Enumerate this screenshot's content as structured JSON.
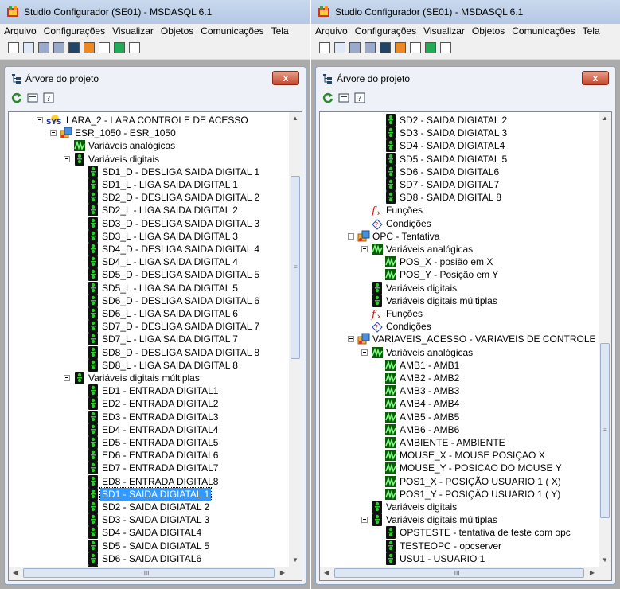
{
  "left": {
    "title": "Studio Configurador (SE01) - MSDASQL 6.1",
    "menu": [
      "Arquivo",
      "Configurações",
      "Visualizar",
      "Objetos",
      "Comunicações",
      "Tela"
    ],
    "panel_title": "Árvore do projeto",
    "close_label": "x",
    "hscroll_grip": "III",
    "vscroll_grip": "≡",
    "tree": [
      {
        "depth": 0,
        "icon": "sys",
        "label": "LARA_2 - LARA CONTROLE DE ACESSO",
        "expander": true
      },
      {
        "depth": 1,
        "icon": "device",
        "label": "ESR_1050 - ESR_1050",
        "expander": true
      },
      {
        "depth": 2,
        "icon": "analog",
        "label": "Variáveis analógicas"
      },
      {
        "depth": 2,
        "icon": "digital",
        "label": "Variáveis digitais",
        "expander": true
      },
      {
        "depth": 3,
        "icon": "digital",
        "label": "SD1_D - DESLIGA SAIDA DIGITAL 1"
      },
      {
        "depth": 3,
        "icon": "digital",
        "label": "SD1_L - LIGA SAIDA DIGITAL 1"
      },
      {
        "depth": 3,
        "icon": "digital",
        "label": "SD2_D - DESLIGA SAIDA DIGITAL 2"
      },
      {
        "depth": 3,
        "icon": "digital",
        "label": "SD2_L - LIGA SAIDA DIGITAL 2"
      },
      {
        "depth": 3,
        "icon": "digital",
        "label": "SD3_D - DESLIGA SAIDA DIGITAL 3"
      },
      {
        "depth": 3,
        "icon": "digital",
        "label": "SD3_L - LIGA SAIDA DIGITAL 3"
      },
      {
        "depth": 3,
        "icon": "digital",
        "label": "SD4_D - DESLIGA SAIDA DIGITAL 4"
      },
      {
        "depth": 3,
        "icon": "digital",
        "label": "SD4_L - LIGA SAIDA DIGITAL 4"
      },
      {
        "depth": 3,
        "icon": "digital",
        "label": "SD5_D - DESLIGA SAIDA DIGITAL 5"
      },
      {
        "depth": 3,
        "icon": "digital",
        "label": "SD5_L - LIGA SAIDA DIGITAL 5"
      },
      {
        "depth": 3,
        "icon": "digital",
        "label": "SD6_D - DESLIGA SAIDA DIGITAL 6"
      },
      {
        "depth": 3,
        "icon": "digital",
        "label": "SD6_L - LIGA SAIDA DIGITAL 6"
      },
      {
        "depth": 3,
        "icon": "digital",
        "label": "SD7_D - DESLIGA SAIDA DIGITAL 7"
      },
      {
        "depth": 3,
        "icon": "digital",
        "label": "SD7_L - LIGA SAIDA DIGITAL 7"
      },
      {
        "depth": 3,
        "icon": "digital",
        "label": "SD8_D - DESLIGA SAIDA DIGITAL 8"
      },
      {
        "depth": 3,
        "icon": "digital",
        "label": "SD8_L - LIGA SAIDA DIGITAL 8"
      },
      {
        "depth": 2,
        "icon": "digital",
        "label": "Variáveis digitais múltiplas",
        "expander": true
      },
      {
        "depth": 3,
        "icon": "digital",
        "label": "ED1 - ENTRADA DIGITAL1"
      },
      {
        "depth": 3,
        "icon": "digital",
        "label": "ED2 - ENTRADA DIGITAL2"
      },
      {
        "depth": 3,
        "icon": "digital",
        "label": "ED3 - ENTRADA DIGITAL3"
      },
      {
        "depth": 3,
        "icon": "digital",
        "label": "ED4 - ENTRADA DIGITAL4"
      },
      {
        "depth": 3,
        "icon": "digital",
        "label": "ED5 - ENTRADA DIGITAL5"
      },
      {
        "depth": 3,
        "icon": "digital",
        "label": "ED6 - ENTRADA DIGITAL6"
      },
      {
        "depth": 3,
        "icon": "digital",
        "label": "ED7 - ENTRADA DIGITAL7"
      },
      {
        "depth": 3,
        "icon": "digital",
        "label": "ED8 - ENTRADA DIGITAL8"
      },
      {
        "depth": 3,
        "icon": "digital",
        "label": "SD1 - SAIDA DIGIATAL 1",
        "selected": true
      },
      {
        "depth": 3,
        "icon": "digital",
        "label": "SD2 - SAIDA DIGIATAL 2"
      },
      {
        "depth": 3,
        "icon": "digital",
        "label": "SD3 - SAIDA DIGIATAL 3"
      },
      {
        "depth": 3,
        "icon": "digital",
        "label": "SD4 - SAIDA DIGITAL4"
      },
      {
        "depth": 3,
        "icon": "digital",
        "label": "SD5 - SAIDA DIGIATAL 5"
      },
      {
        "depth": 3,
        "icon": "digital",
        "label": "SD6 - SAIDA DIGITAL6"
      },
      {
        "depth": 3,
        "icon": "digital",
        "label": "SD7 - SAIDA DIGITAL7"
      }
    ]
  },
  "right": {
    "title": "Studio Configurador (SE01) - MSDASQL 6.1",
    "menu": [
      "Arquivo",
      "Configurações",
      "Visualizar",
      "Objetos",
      "Comunicações",
      "Tela"
    ],
    "panel_title": "Árvore do projeto",
    "close_label": "x",
    "hscroll_grip": "III",
    "vscroll_grip": "≡",
    "tree": [
      {
        "depth": 3,
        "icon": "digital",
        "label": "SD2 - SAIDA DIGIATAL 2"
      },
      {
        "depth": 3,
        "icon": "digital",
        "label": "SD3 - SAIDA DIGIATAL 3"
      },
      {
        "depth": 3,
        "icon": "digital",
        "label": "SD4 - SAIDA DIGIATAL4"
      },
      {
        "depth": 3,
        "icon": "digital",
        "label": "SD5 - SAIDA DIGIATAL 5"
      },
      {
        "depth": 3,
        "icon": "digital",
        "label": "SD6 - SAIDA DIGITAL6"
      },
      {
        "depth": 3,
        "icon": "digital",
        "label": "SD7 - SAIDA DIGITAL7"
      },
      {
        "depth": 3,
        "icon": "digital",
        "label": "SD8 - SAIDA DIGITAL 8"
      },
      {
        "depth": 2,
        "icon": "func",
        "label": "Funções"
      },
      {
        "depth": 2,
        "icon": "cond",
        "label": "Condições"
      },
      {
        "depth": 1,
        "icon": "device",
        "label": "OPC - Tentativa",
        "expander": true
      },
      {
        "depth": 2,
        "icon": "analog",
        "label": "Variáveis analógicas",
        "expander": true
      },
      {
        "depth": 3,
        "icon": "analog",
        "label": "POS_X - posião em X"
      },
      {
        "depth": 3,
        "icon": "analog",
        "label": "POS_Y - Posição em Y"
      },
      {
        "depth": 2,
        "icon": "digital",
        "label": "Variáveis digitais"
      },
      {
        "depth": 2,
        "icon": "digital",
        "label": "Variáveis digitais múltiplas"
      },
      {
        "depth": 2,
        "icon": "func",
        "label": "Funções"
      },
      {
        "depth": 2,
        "icon": "cond",
        "label": "Condições"
      },
      {
        "depth": 1,
        "icon": "device",
        "label": "VARIAVEIS_ACESSO - VARIAVEIS DE CONTROLE",
        "expander": true
      },
      {
        "depth": 2,
        "icon": "analog",
        "label": "Variáveis analógicas",
        "expander": true
      },
      {
        "depth": 3,
        "icon": "analog",
        "label": "AMB1 - AMB1"
      },
      {
        "depth": 3,
        "icon": "analog",
        "label": "AMB2 - AMB2"
      },
      {
        "depth": 3,
        "icon": "analog",
        "label": "AMB3 - AMB3"
      },
      {
        "depth": 3,
        "icon": "analog",
        "label": "AMB4 - AMB4"
      },
      {
        "depth": 3,
        "icon": "analog",
        "label": "AMB5 - AMB5"
      },
      {
        "depth": 3,
        "icon": "analog",
        "label": "AMB6 - AMB6"
      },
      {
        "depth": 3,
        "icon": "analog",
        "label": "AMBIENTE - AMBIENTE"
      },
      {
        "depth": 3,
        "icon": "analog",
        "label": "MOUSE_X - MOUSE POSIÇAO X"
      },
      {
        "depth": 3,
        "icon": "analog",
        "label": "MOUSE_Y - POSICAO DO MOUSE Y"
      },
      {
        "depth": 3,
        "icon": "analog",
        "label": "POS1_X - POSIÇÃO USUARIO 1 ( X)"
      },
      {
        "depth": 3,
        "icon": "analog",
        "label": "POS1_Y - POSIÇÃO USUARIO 1 ( Y)"
      },
      {
        "depth": 2,
        "icon": "digital",
        "label": "Variáveis digitais"
      },
      {
        "depth": 2,
        "icon": "digital",
        "label": "Variáveis digitais múltiplas",
        "expander": true
      },
      {
        "depth": 3,
        "icon": "digital",
        "label": "OPSTESTE - tentativa de teste com opc"
      },
      {
        "depth": 3,
        "icon": "digital",
        "label": "TESTEOPC - opcserver"
      },
      {
        "depth": 3,
        "icon": "digital",
        "label": "USU1 - USUARIO 1"
      },
      {
        "depth": 2,
        "icon": "func",
        "label": "Funções"
      }
    ]
  },
  "colors": {
    "selection": "#3399ff",
    "close_button": "#c7472c",
    "client_bg": "#ababab",
    "panel_bg": "#eef2f8"
  }
}
